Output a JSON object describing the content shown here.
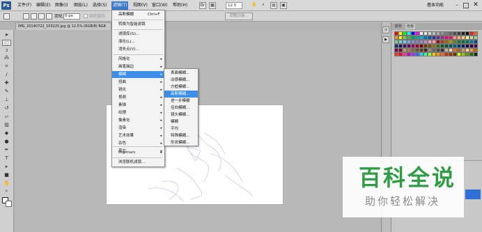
{
  "menubar": {
    "logo": "Ps",
    "items": [
      "文件(F)",
      "编辑(E)",
      "图像(I)",
      "图层(L)",
      "选择(S)",
      "滤镜(T)",
      "视图(V)",
      "窗口(W)",
      "帮助(H)"
    ],
    "zoom": "12.5",
    "workspace": "基本功能"
  },
  "options": {
    "feather_label": "羽化:",
    "feather_value": "0 px",
    "antialias": "消除锯齿",
    "refine_edge": "调整边缘..."
  },
  "document": {
    "tab_title": "IMG_20140722_103225.jpg @ 12.5% (RGB/8) RG8"
  },
  "swatches": {
    "tab_color": "颜色",
    "tab_swatches": "色板",
    "colors": [
      "#ff0000",
      "#ffff00",
      "#00ff00",
      "#00ffff",
      "#0000ff",
      "#ff00ff",
      "#ffffff",
      "#ebebeb",
      "#d6d6d6",
      "#c0c0c0",
      "#a9a9a9",
      "#939393",
      "#7d7d7d",
      "#666666",
      "#505050",
      "#3a3a3a",
      "#232323",
      "#000000",
      "#ed1c24",
      "#f26522",
      "#f7941d",
      "#fff200",
      "#8dc63f",
      "#39b54a",
      "#00a651",
      "#00a99d",
      "#00aeef",
      "#0072bc",
      "#0054a6",
      "#2e3192",
      "#662d91",
      "#92278f",
      "#ec008c",
      "#ed145b",
      "#f69679",
      "#f9ad81",
      "#fdc68a",
      "#fff799",
      "#c4df9b",
      "#a3d39c",
      "#82ca9c",
      "#7accc8",
      "#6dcff6",
      "#7da7d9",
      "#8393ca",
      "#8781bd",
      "#a186be",
      "#bd8cbf",
      "#f49ac1",
      "#f5989d",
      "#9e0b0f",
      "#a0410d",
      "#a36209",
      "#aba000",
      "#598527",
      "#1a7b30",
      "#007236",
      "#00746b",
      "#0076a3",
      "#004b80",
      "#003471",
      "#1b1464",
      "#440e62",
      "#630460",
      "#9e005d",
      "#9e0039",
      "#790000",
      "#7b2e00",
      "#7d4900",
      "#827b00",
      "#406618",
      "#005e20",
      "#005826",
      "#005952",
      "#005b7f",
      "#003663",
      "#002157",
      "#0d004c",
      "#32004b",
      "#4b0049",
      "#7b0046",
      "#7a0026",
      "#c69c6d",
      "#a67c52",
      "#8c6239",
      "#754c24",
      "#603913",
      "#3c2415",
      "#998675",
      "#736357",
      "#534741",
      "#362f2d",
      "#c7b299",
      "#e8d8c4",
      "#ff6600",
      "#996633",
      "#cc9966",
      "#ffcc99",
      "#ff9933",
      "#cc6600",
      "#ff3300",
      "#ff0033",
      "#ff3399",
      "#cc00cc",
      "#9933ff",
      "#3366ff",
      "#33ccff",
      "#33ff99",
      "#99ff33",
      "#ffcc00",
      "#ff9900",
      "#ff6633",
      "#cc3300",
      "#993300",
      "#663300",
      "#ccff00",
      "#99cc00",
      "#669900",
      "#336600",
      "#003300"
    ]
  },
  "filter_menu": {
    "items": [
      {
        "label": "高斯模糊",
        "shortcut": "Ctrl+F"
      },
      {
        "label": "转换为智能滤镜"
      },
      {
        "label": "滤镜库(G)..."
      },
      {
        "label": "液化(L)..."
      },
      {
        "label": "消失点(V)..."
      },
      {
        "label": "风格化"
      },
      {
        "label": "画笔描边"
      },
      {
        "label": "模糊"
      },
      {
        "label": "扭曲"
      },
      {
        "label": "锐化"
      },
      {
        "label": "视频"
      },
      {
        "label": "素描"
      },
      {
        "label": "纹理"
      },
      {
        "label": "像素化"
      },
      {
        "label": "渲染"
      },
      {
        "label": "艺术效果"
      },
      {
        "label": "杂色"
      },
      {
        "label": "其它"
      },
      {
        "label": "Digimarc"
      },
      {
        "label": "浏览联机滤镜..."
      }
    ]
  },
  "blur_menu": {
    "items": [
      "表面模糊...",
      "动感模糊...",
      "方框模糊...",
      "高斯模糊...",
      "进一步模糊",
      "径向模糊...",
      "镜头模糊...",
      "模糊",
      "平均",
      "特殊模糊...",
      "形状模糊..."
    ]
  },
  "watermark": {
    "title": "百科全说",
    "subtitle": "助你轻松解决"
  }
}
